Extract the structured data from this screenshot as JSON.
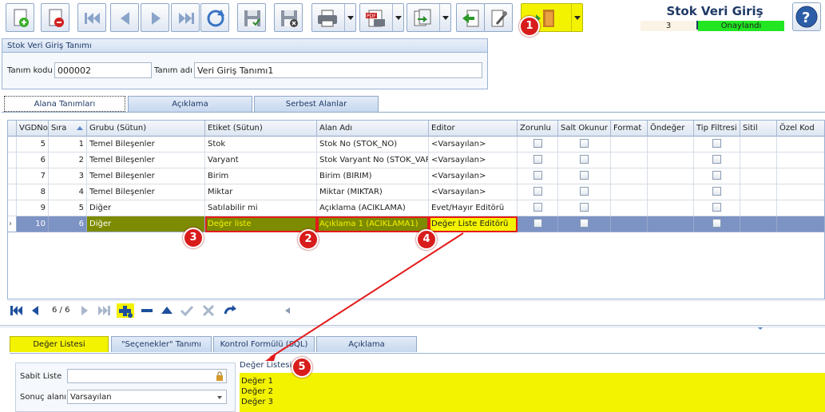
{
  "header": {
    "form_title": "Stok Veri Giriş Tanımı",
    "record_number": "3",
    "status": "Onaylandı"
  },
  "toolbar": {
    "buttons": [
      "new-icon",
      "delete-icon",
      "first-icon",
      "previous-icon",
      "next-icon",
      "last-icon",
      "refresh-icon",
      "save-icon",
      "cancel-save-icon",
      "print-icon",
      "pdf-icon",
      "export-icon",
      "import-icon",
      "tools-icon",
      "exit-icon",
      "help-icon"
    ]
  },
  "definition": {
    "group_title": "Stok Veri Giriş Tanımı",
    "code_label": "Tanım kodu",
    "code_value": "000002",
    "name_label": "Tanım adı",
    "name_value": "Veri Giriş Tanımı1"
  },
  "top_tabs": [
    "Alana Tanımları",
    "Açıklama",
    "Serbest Alanlar"
  ],
  "grid": {
    "headers": [
      "VGDNo",
      "Sıra",
      "Grubu (Sütun)",
      "Etiket (Sütun)",
      "Alan Adı",
      "Editor",
      "Zorunlu",
      "Salt Okunur",
      "Format",
      "Öndeğer",
      "Tip Filtresi",
      "Sitil",
      "Özel Kod"
    ],
    "rows": [
      {
        "vgdno": "5",
        "sira": "1",
        "grup": "Temel Bileşenler",
        "etiket": "Stok",
        "alan": "Stok No (STOK_NO)",
        "editor": "<Varsayılan>"
      },
      {
        "vgdno": "6",
        "sira": "2",
        "grup": "Temel Bileşenler",
        "etiket": "Varyant",
        "alan": "Stok Varyant No (STOK_VAR",
        "editor": "<Varsayılan>"
      },
      {
        "vgdno": "7",
        "sira": "3",
        "grup": "Temel Bileşenler",
        "etiket": "Birim",
        "alan": "Birim (BIRIM)",
        "editor": "<Varsayılan>"
      },
      {
        "vgdno": "8",
        "sira": "4",
        "grup": "Temel Bileşenler",
        "etiket": "Miktar",
        "alan": "Miktar (MIKTAR)",
        "editor": "<Varsayılan>"
      },
      {
        "vgdno": "9",
        "sira": "5",
        "grup": "Diğer",
        "etiket": "Satılabilir mi",
        "alan": "Açıklama (ACIKLAMA)",
        "editor": "Evet/Hayır Editörü"
      },
      {
        "vgdno": "10",
        "sira": "6",
        "grup": "Diğer",
        "etiket": "Değer liste",
        "alan": "Açıklama 1 (ACIKLAMA1)",
        "editor": "Değer Liste Editörü"
      }
    ]
  },
  "navigator": {
    "position": "6 / 6"
  },
  "bottom_tabs": [
    "Değer Listesi",
    "\"Seçenekler\" Tanımı",
    "Kontrol Formülü (SQL)",
    "Açıklama"
  ],
  "value_panel": {
    "fixed_list_label": "Sabit Liste",
    "result_label": "Sonuç alanı",
    "result_value": "Varsayılan",
    "list_label": "Değer Listesi",
    "list_items": [
      "Değer 1",
      "Değer 2",
      "Değer 3"
    ]
  },
  "annotations": [
    "1",
    "2",
    "3",
    "4",
    "5"
  ],
  "colors": {
    "highlight": "#f3f300",
    "callout": "#d81c1c",
    "approved": "#22e622",
    "selection": "#7d93c4"
  }
}
